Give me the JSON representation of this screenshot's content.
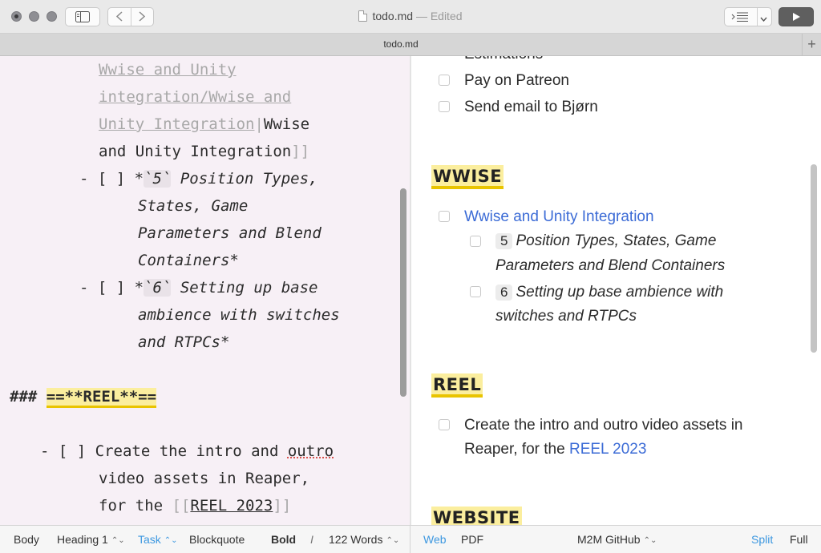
{
  "window": {
    "title": "todo.md",
    "edited_label": "— Edited",
    "tab_title": "todo.md",
    "tab_add": "+"
  },
  "toolbar": {
    "sidebar_icon": "sidebar-toggle-icon",
    "back_icon": "chevron-left-icon",
    "forward_icon": "chevron-right-icon",
    "view_icon": "list-indent-icon",
    "dropdown_icon": "chevron-down-icon",
    "play_icon": "play-icon"
  },
  "editor": {
    "line1_link": "Wwise and Unity",
    "line2_link": "integration/Wwise and",
    "line3_link": "Unity Integration",
    "line3_pipe": "|",
    "line3_text": "Wwise",
    "line4_text": "and Unity Integration",
    "line4_close": "]]",
    "task1_prefix": "- [ ] ",
    "task1_star": "*",
    "task1_code": "`5`",
    "task1_l1": " Position Types,",
    "task1_l2": "States, Game",
    "task1_l3": "Parameters and Blend",
    "task1_l4": "Containers*",
    "task2_prefix": "- [ ] ",
    "task2_star": "*",
    "task2_code": "`6`",
    "task2_l1": " Setting up base",
    "task2_l2": "ambience with switches",
    "task2_l3": "and RTPCs*",
    "heading_prefix": "### ",
    "heading_text": "==**REEL**==",
    "task3_prefix": "- [ ] ",
    "task3_l1a": "Create the intro and ",
    "task3_l1b": "outro",
    "task3_l2": "video assets in Reaper,",
    "task3_l3a": "for the ",
    "task3_open": "[[",
    "task3_link": "REEL 2023",
    "task3_close": "]]"
  },
  "preview": {
    "partial_item": "Estimations",
    "item_patreon": "Pay on Patreon",
    "item_email": "Send email to Bjørn",
    "heading_wwise": "WWISE",
    "wwise_link": "Wwise and Unity Integration",
    "sub1_badge": "5",
    "sub1_l1": "Position Types, States, Game",
    "sub1_l2": "Parameters and Blend Containers",
    "sub2_badge": "6",
    "sub2_l1": "Setting up base ambience with",
    "sub2_l2": "switches and RTPCs",
    "heading_reel": "REEL",
    "reel_l1": "Create the intro and outro video assets in",
    "reel_l2a": "Reaper, for the ",
    "reel_link": "REEL 2023",
    "heading_website": "WEBSITE"
  },
  "statusbar": {
    "body": "Body",
    "heading": "Heading 1",
    "task": "Task",
    "blockquote": "Blockquote",
    "bold": "Bold",
    "italic": "I",
    "words": "122 Words",
    "web": "Web",
    "pdf": "PDF",
    "theme": "M2M GitHub",
    "split": "Split",
    "full": "Full",
    "updown_glyph": "⌃⌄"
  },
  "colors": {
    "highlight": "#fbee9e",
    "highlight_border": "#e9c400",
    "link": "#3b6bd6",
    "status_accent": "#3d98e0",
    "editor_bg": "#f7f0f6"
  }
}
